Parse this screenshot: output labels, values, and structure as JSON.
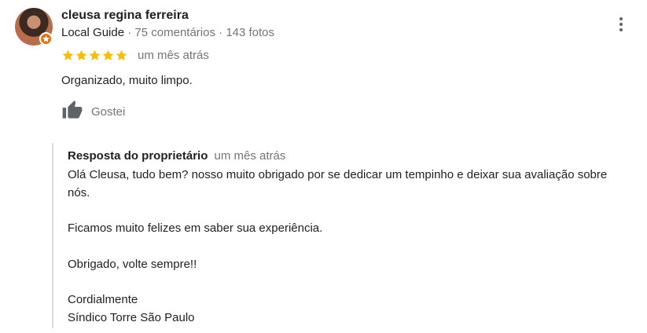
{
  "reviewer": {
    "name": "cleusa regina ferreira",
    "level": "Local Guide",
    "separator": "·",
    "reviews": "75 comentários",
    "photos": "143 fotos"
  },
  "rating": {
    "stars": 5,
    "max": 5,
    "color": "#fbbc04"
  },
  "review": {
    "date": "um mês atrás",
    "text": "Organizado, muito limpo."
  },
  "like": {
    "label": "Gostei"
  },
  "owner_reply": {
    "title": "Resposta do proprietário",
    "date": "um mês atrás",
    "lines": [
      "Olá Cleusa, tudo bem? nosso muito obrigado por se dedicar um tempinho e deixar sua avaliação sobre",
      "nós.",
      "",
      "Ficamos muito felizes em saber sua experiência.",
      "",
      "Obrigado, volte sempre!!",
      "",
      "Cordialmente",
      "Síndico Torre São Paulo"
    ]
  },
  "icons": {
    "more": "more-vert-icon",
    "like": "thumb-up-icon",
    "badge": "local-guide-star-icon",
    "star": "star-icon"
  },
  "colors": {
    "accent_badge": "#e8710a",
    "text_secondary": "#70757a",
    "divider": "#dadce0"
  }
}
